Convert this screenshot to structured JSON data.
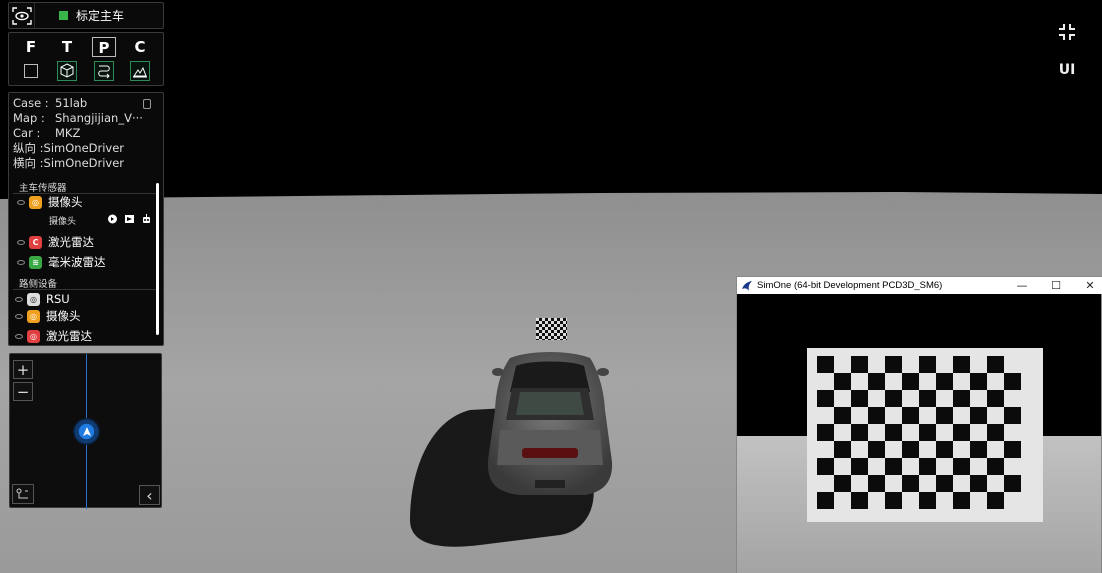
{
  "header": {
    "title": "标定主车",
    "status_color": "#3ab54a"
  },
  "views": [
    {
      "letter": "F",
      "icon": "square-icon",
      "active": false
    },
    {
      "letter": "T",
      "icon": "cube-icon",
      "active": false
    },
    {
      "letter": "P",
      "icon": "path-icon",
      "active": true
    },
    {
      "letter": "C",
      "icon": "terrain-icon",
      "active": false
    }
  ],
  "info": {
    "case_label": "Case :",
    "case_value": "51lab",
    "map_label": "Map :",
    "map_value": "Shangjijian_V···",
    "car_label": "Car :",
    "car_value": "MKZ",
    "long_label": "纵向 :",
    "long_value": "SimOneDriver",
    "lat_label": "横向 :",
    "lat_value": "SimOneDriver"
  },
  "sensors": {
    "main_title": "主车传感器",
    "main_items": [
      {
        "label": "摄像头",
        "badge": "◎",
        "color": "#f0a020"
      },
      {
        "label": "激光雷达",
        "badge": "C",
        "color": "#e04040"
      },
      {
        "label": "毫米波雷达",
        "badge": "≋",
        "color": "#3aa845"
      }
    ],
    "sub_label": "摄像头",
    "road_title": "路侧设备",
    "road_items": [
      {
        "label": "RSU",
        "badge": "◎",
        "color": "#dddddd"
      },
      {
        "label": "摄像头",
        "badge": "◎",
        "color": "#f0a020"
      },
      {
        "label": "激光雷达",
        "badge": "◎",
        "color": "#e04040"
      }
    ]
  },
  "minimap": {
    "zoom_in": "+",
    "zoom_out": "−",
    "collapse": "‹"
  },
  "top_right": {
    "ui_label": "UI"
  },
  "window": {
    "title": "SimOne (64-bit Development PCD3D_SM6)",
    "minimize": "—",
    "maximize": "☐",
    "close": "✕"
  }
}
